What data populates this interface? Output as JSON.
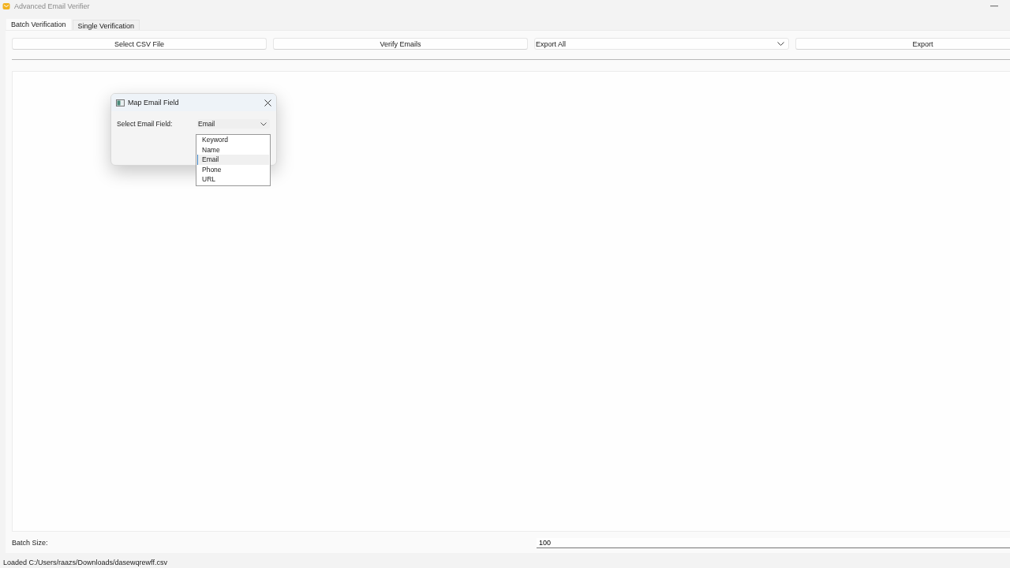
{
  "window": {
    "title": "Advanced Email Verifier"
  },
  "tabs": [
    {
      "label": "Batch Verification",
      "selected": true
    },
    {
      "label": "Single Verification",
      "selected": false
    }
  ],
  "toolbar": {
    "buttons": [
      "Select CSV File",
      "Verify Emails"
    ],
    "export_mode": {
      "value": "Export All"
    },
    "export_button": "Export"
  },
  "batch_size": {
    "label": "Batch Size:",
    "value": "100"
  },
  "status_bar": "Loaded C:/Users/raazs/Downloads/dasewqrewff.csv",
  "dialog": {
    "title": "Map Email Field",
    "label": "Select Email Field:",
    "value": "Email",
    "options": [
      {
        "label": "Keyword",
        "selected": false
      },
      {
        "label": "Name",
        "selected": false
      },
      {
        "label": "Email",
        "selected": true
      },
      {
        "label": "Phone",
        "selected": false
      },
      {
        "label": "URL",
        "selected": false
      }
    ]
  }
}
